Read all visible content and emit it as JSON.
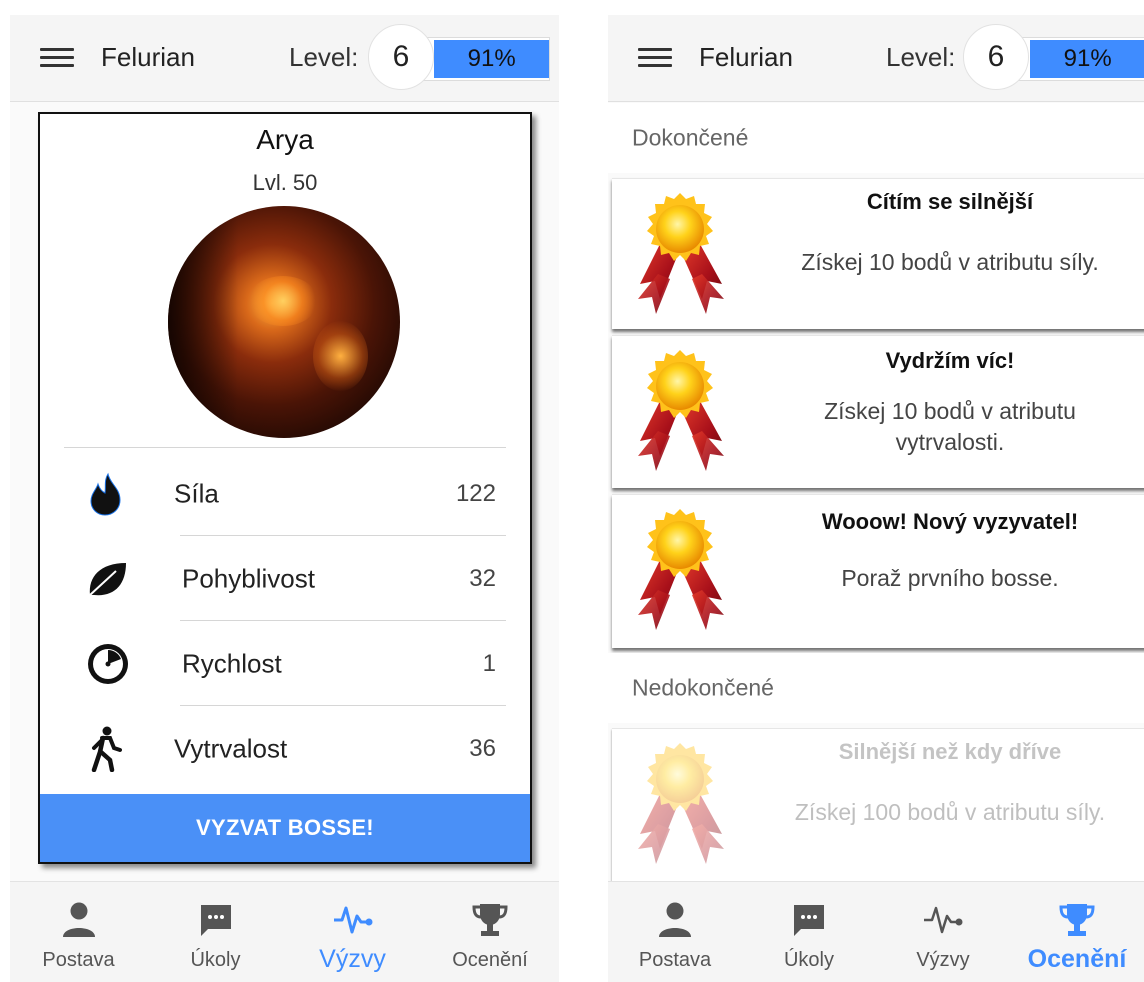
{
  "left": {
    "appbar": {
      "username": "Felurian",
      "level_label": "Level:",
      "level": "6",
      "progress": "91%",
      "progress_fraction": 0.91
    },
    "character": {
      "name": "Arya",
      "level": "Lvl. 50",
      "stats": [
        {
          "icon": "flame-icon",
          "label": "Síla",
          "value": "122"
        },
        {
          "icon": "leaf-icon",
          "label": "Pohyblivost",
          "value": "32"
        },
        {
          "icon": "stopwatch-icon",
          "label": "Rychlost",
          "value": "1"
        },
        {
          "icon": "walking-person-icon",
          "label": "Vytrvalost",
          "value": "36"
        }
      ],
      "boss_button": "VYZVAT BOSSE!"
    },
    "nav": [
      {
        "icon": "person-icon",
        "label": "Postava"
      },
      {
        "icon": "chat-icon",
        "label": "Úkoly"
      },
      {
        "icon": "pulse-icon",
        "label": "Výzvy",
        "active": true
      },
      {
        "icon": "trophy-icon",
        "label": "Ocenění"
      }
    ]
  },
  "right": {
    "appbar": {
      "username": "Felurian",
      "level_label": "Level:",
      "level": "6",
      "progress": "91%",
      "progress_fraction": 0.91
    },
    "completed_header": "Dokončené",
    "incomplete_header": "Nedokončené",
    "completed": [
      {
        "title": "Cítím se silnější",
        "desc": "Získej 10 bodů v atributu síly."
      },
      {
        "title": "Vydržím víc!",
        "desc": "Získej 10 bodů v atributu vytrvalosti."
      },
      {
        "title": "Wooow! Nový vyzyvatel!",
        "desc": "Poraž prvního bosse."
      }
    ],
    "incomplete": [
      {
        "title": "Silnější než kdy dříve",
        "desc": "Získej 100 bodů v atributu síly."
      }
    ],
    "nav": [
      {
        "icon": "person-icon",
        "label": "Postava"
      },
      {
        "icon": "chat-icon",
        "label": "Úkoly"
      },
      {
        "icon": "pulse-icon",
        "label": "Výzvy"
      },
      {
        "icon": "trophy-icon",
        "label": "Ocenění",
        "active": true
      }
    ]
  },
  "colors": {
    "accent": "#4a90f7",
    "progress": "#3f8cff",
    "medal_gold": "#f5b400",
    "ribbon_red": "#b3121a"
  }
}
